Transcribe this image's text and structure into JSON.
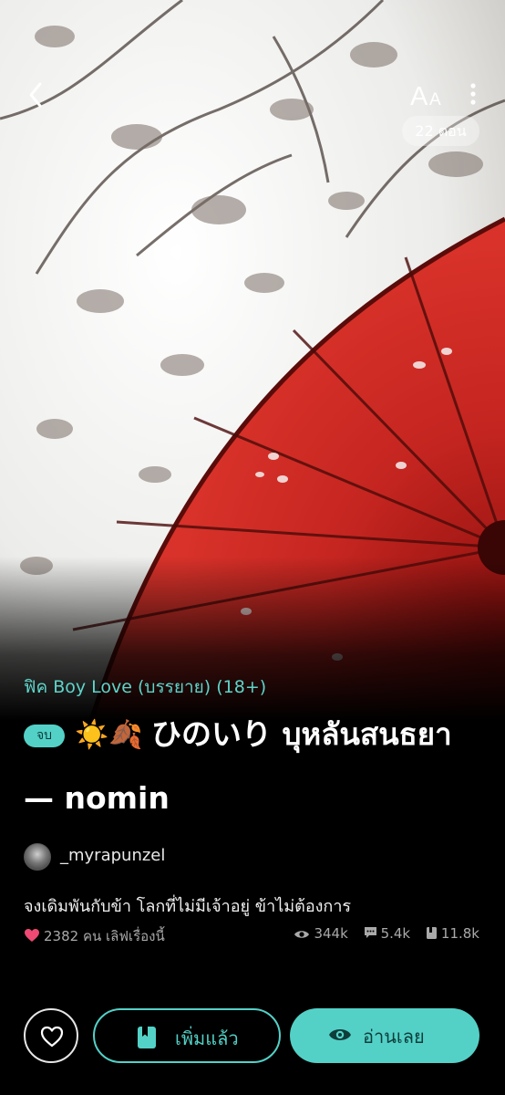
{
  "header": {
    "back_icon": "chevron-left-icon",
    "font_size_label": "AA",
    "more_icon": "vertical-dots-icon",
    "chapter_count": "22 ตอน"
  },
  "story": {
    "genre": "ฟิค Boy Love (บรรยาย) (18+)",
    "status_badge": "จบ",
    "title_emoji": "☀️🍂",
    "title_line1": "ひのいり บุหลันสนธยา",
    "title_line2": "— nomin",
    "author": "_myrapunzel",
    "tagline": "จงเดิมพันกับข้า โลกที่ไม่มีเจ้าอยู่ ข้าไม่ต้องการ",
    "likes": "2382 คน เลิฟเรื่องนี้",
    "views": "344k",
    "comments": "5.4k",
    "saves": "11.8k"
  },
  "actions": {
    "favorite_icon": "heart-outline-icon",
    "added_label": "เพิ่มแล้ว",
    "read_label": "อ่านเลย"
  },
  "colors": {
    "accent": "#53d1c7",
    "umbrella": "#c8231f",
    "background": "#000000"
  }
}
